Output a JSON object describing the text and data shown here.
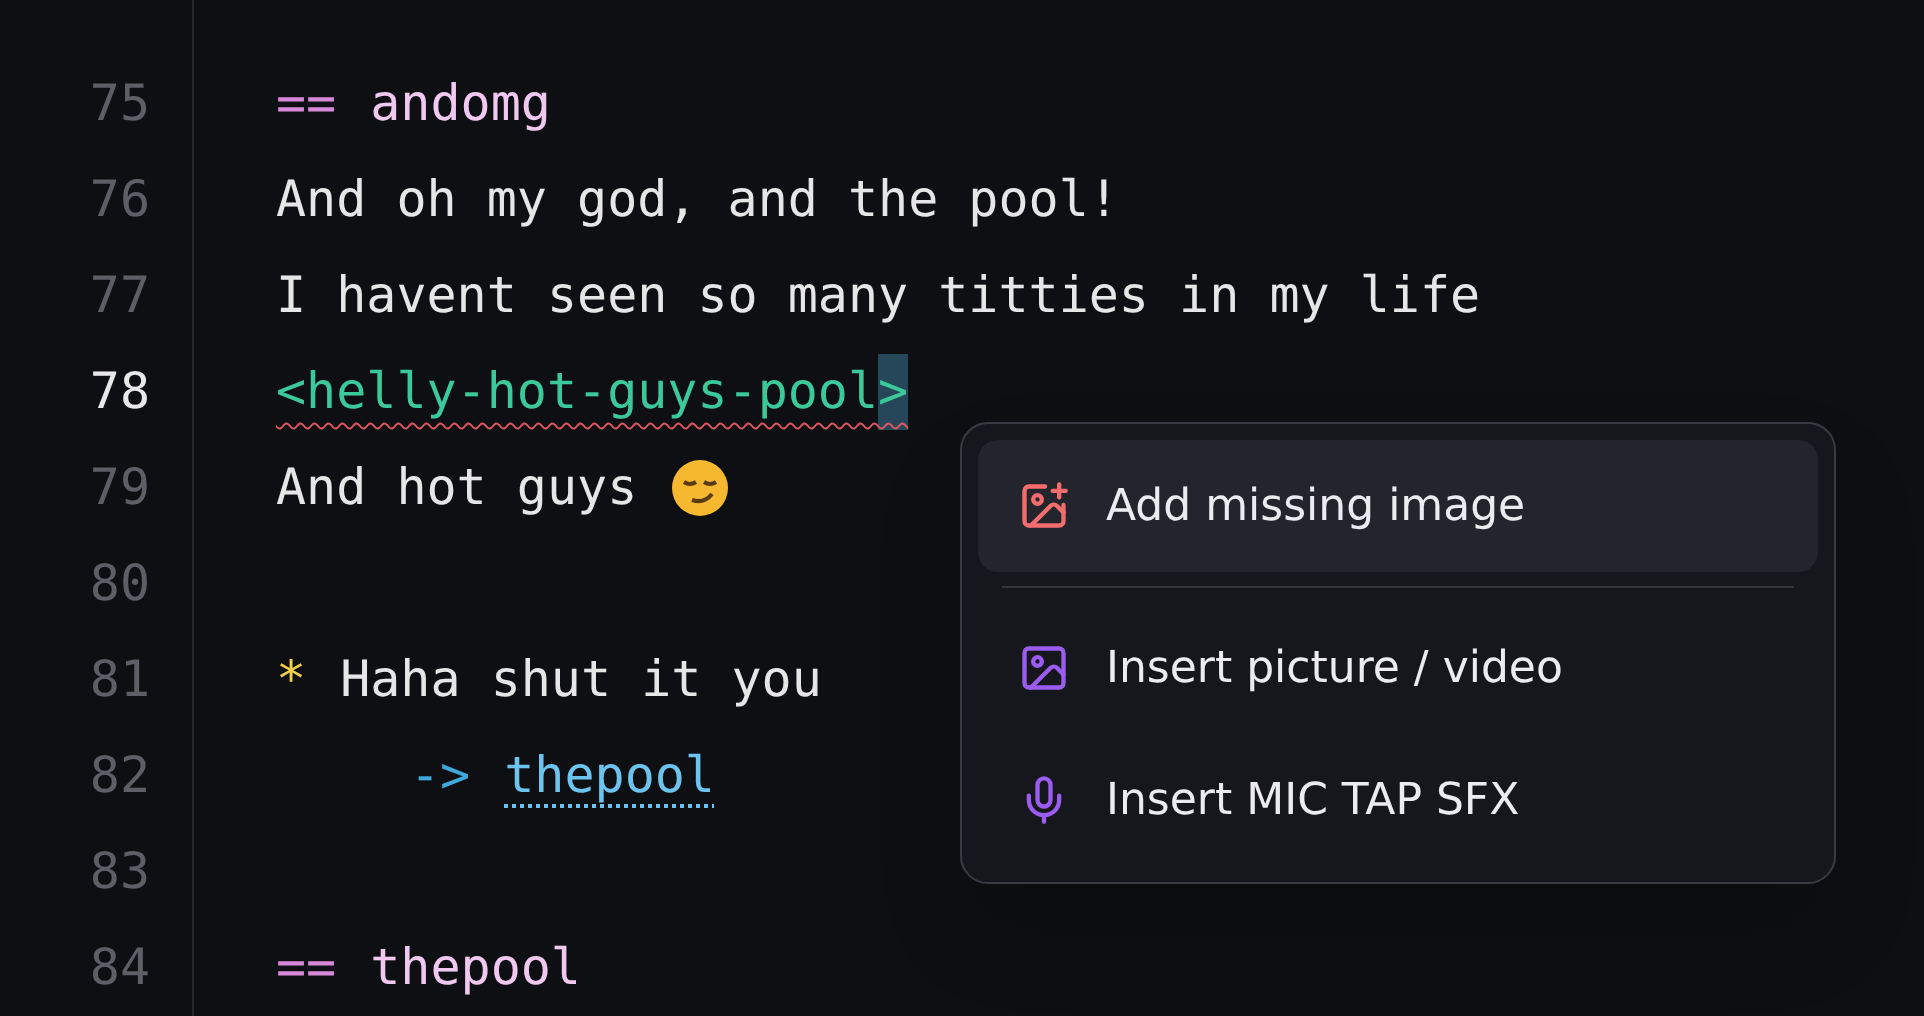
{
  "editor": {
    "lines": [
      {
        "number": "75",
        "current": false,
        "kind": "knot",
        "marker": "==",
        "text": "andomg"
      },
      {
        "number": "76",
        "current": false,
        "kind": "text",
        "text": "And oh my god, and the pool!"
      },
      {
        "number": "77",
        "current": false,
        "kind": "text",
        "text": "I havent seen so many titties in my life"
      },
      {
        "number": "78",
        "current": true,
        "kind": "tag",
        "text": "<helly-hot-guys-pool",
        "cursor_char": ">",
        "error": true
      },
      {
        "number": "79",
        "current": false,
        "kind": "text",
        "text": "And hot guys",
        "emoji": true
      },
      {
        "number": "80",
        "current": false,
        "kind": "blank"
      },
      {
        "number": "81",
        "current": false,
        "kind": "choice",
        "marker": "*",
        "text": "Haha shut it you"
      },
      {
        "number": "82",
        "current": false,
        "kind": "divert",
        "marker": "->",
        "text": "thepool"
      },
      {
        "number": "83",
        "current": false,
        "kind": "blank"
      },
      {
        "number": "84",
        "current": false,
        "kind": "knot",
        "marker": "==",
        "text": "thepool"
      }
    ]
  },
  "context_menu": {
    "items": [
      {
        "kind": "add-image",
        "label": "Add missing image",
        "color": "#f26d6d",
        "selected": true
      },
      {
        "kind": "separator"
      },
      {
        "kind": "insert-media",
        "label": "Insert picture / video",
        "color": "#9b5cf0",
        "selected": false
      },
      {
        "kind": "insert-sound",
        "label": "Insert MIC TAP SFX",
        "color": "#9b5cf0",
        "selected": false
      }
    ]
  }
}
